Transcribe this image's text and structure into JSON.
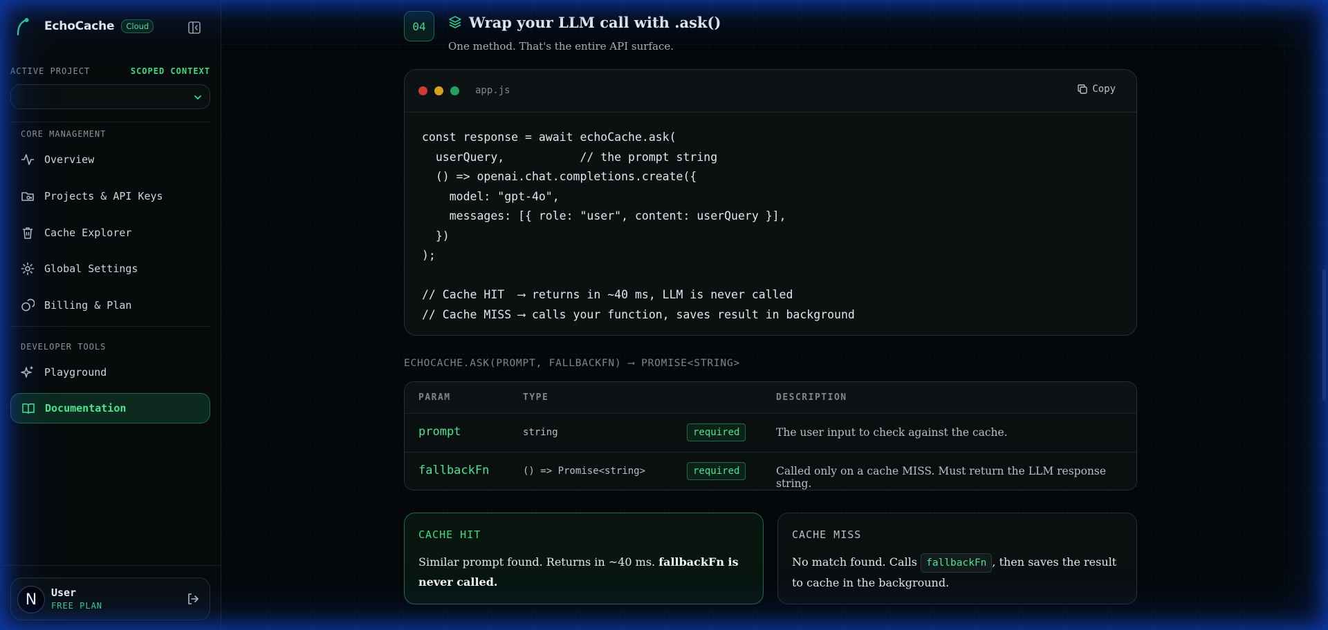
{
  "brand": {
    "name": "EchoCache",
    "badge": "Cloud"
  },
  "project": {
    "label": "ACTIVE PROJECT",
    "scoped": "SCOPED CONTEXT",
    "selected": ""
  },
  "nav": {
    "core_label": "CORE MANAGEMENT",
    "core_items": [
      {
        "label": "Overview",
        "icon": "activity-icon"
      },
      {
        "label": "Projects & API Keys",
        "icon": "folder-key-icon"
      },
      {
        "label": "Cache Explorer",
        "icon": "trash-icon"
      },
      {
        "label": "Global Settings",
        "icon": "gear-icon"
      },
      {
        "label": "Billing & Plan",
        "icon": "coins-icon"
      }
    ],
    "dev_label": "DEVELOPER TOOLS",
    "dev_items": [
      {
        "label": "Playground",
        "icon": "sparkles-icon"
      },
      {
        "label": "Documentation",
        "icon": "book-open-icon",
        "active": true
      }
    ]
  },
  "user": {
    "avatar_letter": "N",
    "name": "User",
    "plan": "FREE PLAN"
  },
  "step": {
    "number": "04",
    "title": "Wrap your LLM call with .ask()",
    "subtitle": "One method. That's the entire API surface."
  },
  "code": {
    "filename": "app.js",
    "copy_label": "Copy",
    "lines": [
      "const response = await echoCache.ask(",
      "  userQuery,           // the prompt string",
      "  () => openai.chat.completions.create({",
      "    model: \"gpt-4o\",",
      "    messages: [{ role: \"user\", content: userQuery }],",
      "  })",
      ");",
      "",
      "// Cache HIT  ⟶ returns in ~40 ms, LLM is never called",
      "// Cache MISS ⟶ calls your function, saves result in background"
    ]
  },
  "signature": "ECHOCACHE.ASK(PROMPT, FALLBACKFN) ⟶ PROMISE<STRING>",
  "params_table": {
    "headers": [
      "PARAM",
      "TYPE",
      "DESCRIPTION"
    ],
    "rows": [
      {
        "param": "prompt",
        "type": "string",
        "required": "required",
        "description": "The user input to check against the cache."
      },
      {
        "param": "fallbackFn",
        "type": "() => Promise<string>",
        "required": "required",
        "description": "Called only on a cache MISS. Must return the LLM response string."
      }
    ]
  },
  "hit_card": {
    "title": "CACHE HIT",
    "text": "Similar prompt found. Returns in ~40 ms. ",
    "bold": "fallbackFn is never called."
  },
  "miss_card": {
    "title": "CACHE MISS",
    "text_before": "No match found. Calls ",
    "code": "fallbackFn",
    "text_after": ", then saves the result to cache in the background."
  },
  "colors": {
    "accent": "#3ddc84",
    "background": "#04080a",
    "frame_glow": "#0e3aa8"
  }
}
